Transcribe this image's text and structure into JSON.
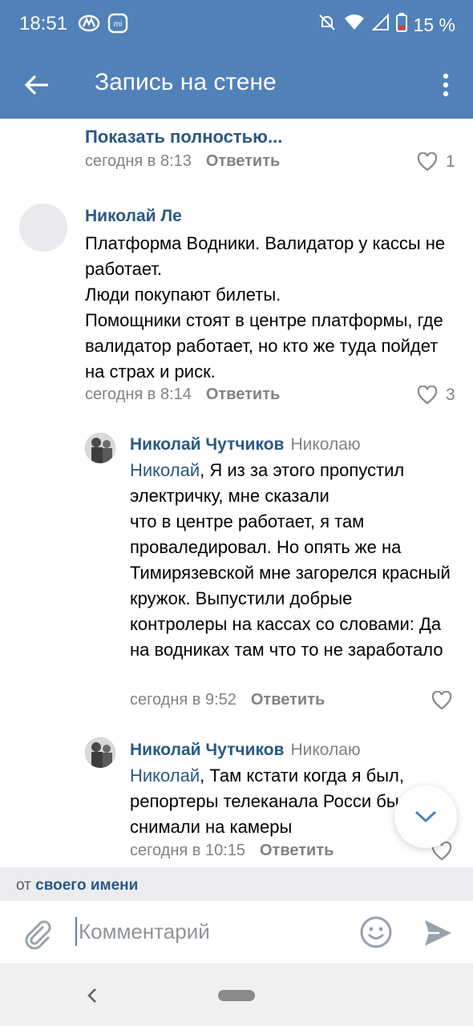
{
  "status_bar": {
    "time": "18:51",
    "battery": "15 %",
    "icons": [
      "metro-icon",
      "mi-icon",
      "mute-icon",
      "wifi-icon",
      "signal-icon",
      "battery-icon"
    ]
  },
  "app_bar": {
    "title": "Запись на стене"
  },
  "comments": [
    {
      "show_more": "Показать полностью...",
      "time": "сегодня в 8:13",
      "reply_label": "Ответить",
      "likes": "1"
    },
    {
      "author": "Николай Ле",
      "text": "Платформа Водники. Валидатор у кассы не работает.\nЛюди покупают билеты.\nПомощники стоят в центре платформы, где валидатор работает, но кто же туда пойдет на страх и риск.",
      "time": "сегодня в 8:14",
      "reply_label": "Ответить",
      "likes": "3"
    },
    {
      "author": "Николай Чутчиков",
      "reply_to": "Николаю",
      "mention": "Николай",
      "text": ", Я из за этого пропустил электричку, мне сказали\nчто в центре работает, я там проваледировал. Но опять же на Тимирязевской мне загорелся красный кружок. Выпустили добрые контролеры на кассах со словами: Да на водниках там что то не заработало",
      "time": "сегодня в 9:52",
      "reply_label": "Ответить"
    },
    {
      "author": "Николай Чутчиков",
      "reply_to": "Николаю",
      "mention": "Николай",
      "text": ", Там кстати когда я был, репортеры телеканала Росси были, снимали на камеры",
      "time": "сегодня в 10:15",
      "reply_label": "Ответить"
    }
  ],
  "composer": {
    "from_prefix": "от",
    "from_link": "своего имени",
    "placeholder": "Комментарий"
  },
  "colors": {
    "brand": "#5181b8",
    "link": "#2a5885",
    "muted": "#828282"
  }
}
